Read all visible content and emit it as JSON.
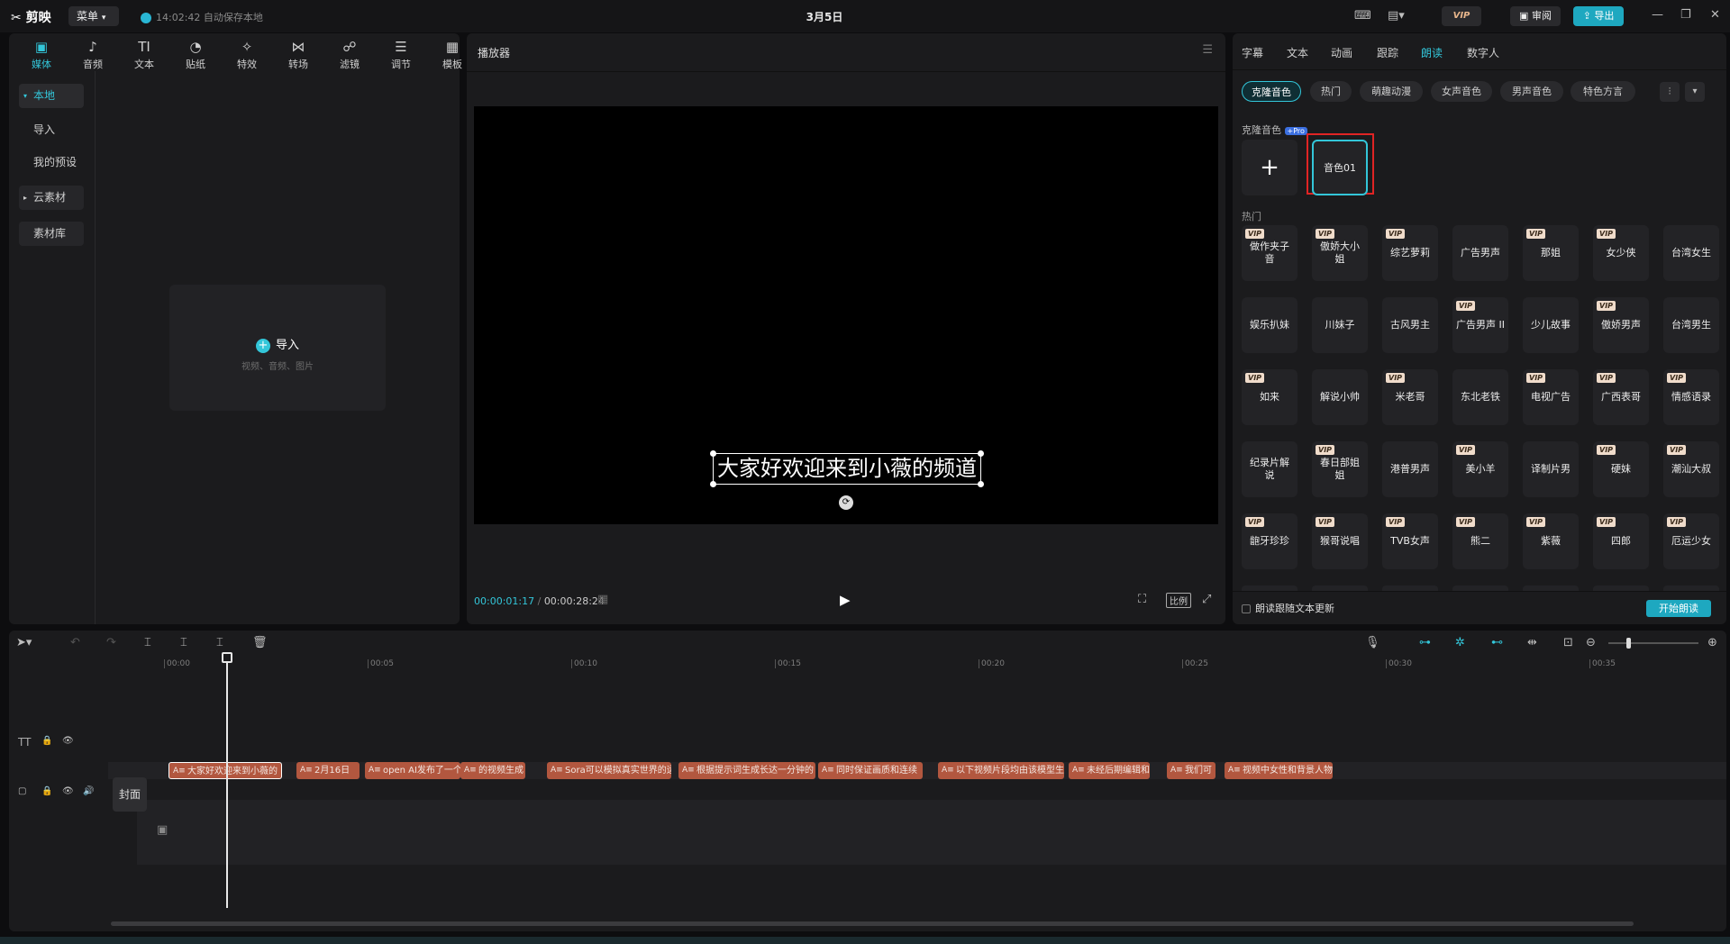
{
  "app": {
    "logo": "剪映",
    "menu": "菜单",
    "autosave": "14:02:42 自动保存本地",
    "title": "3月5日",
    "vip": "VIP",
    "review": "审阅",
    "export": "导出"
  },
  "toolbar": [
    {
      "label": "媒体",
      "icon": "media-icon"
    },
    {
      "label": "音频",
      "icon": "audio-icon"
    },
    {
      "label": "文本",
      "icon": "text-icon"
    },
    {
      "label": "贴纸",
      "icon": "sticker-icon"
    },
    {
      "label": "特效",
      "icon": "effects-icon"
    },
    {
      "label": "转场",
      "icon": "transition-icon"
    },
    {
      "label": "滤镜",
      "icon": "filter-icon"
    },
    {
      "label": "调节",
      "icon": "adjust-icon"
    },
    {
      "label": "模板",
      "icon": "template-icon"
    }
  ],
  "sidebar": {
    "local": "本地",
    "import": "导入",
    "presets": "我的预设",
    "cloud": "云素材",
    "library": "素材库"
  },
  "import_box": {
    "label": "导入",
    "hint": "视频、音频、图片"
  },
  "player": {
    "title": "播放器",
    "caption": "大家好欢迎来到小薇的频道",
    "current_time": "00:00:01:17",
    "total_time": "00:00:28:24",
    "ratio": "比例"
  },
  "right_tabs": [
    "字幕",
    "文本",
    "动画",
    "跟踪",
    "朗读",
    "数字人"
  ],
  "right_active_tab": "朗读",
  "voice_filters": [
    "克隆音色",
    "热门",
    "萌趣动漫",
    "女声音色",
    "男声音色",
    "特色方言"
  ],
  "clone_section": {
    "title": "克隆音色",
    "badge": "+Pro",
    "add": "+",
    "voice": "音色01"
  },
  "hot_section": {
    "title": "热门"
  },
  "voices": [
    {
      "name": "做作夹子音",
      "vip": true
    },
    {
      "name": "傲娇大小姐",
      "vip": true
    },
    {
      "name": "综艺萝莉",
      "vip": true
    },
    {
      "name": "广告男声",
      "vip": false
    },
    {
      "name": "那姐",
      "vip": true
    },
    {
      "name": "女少侠",
      "vip": true
    },
    {
      "name": "台湾女生",
      "vip": false
    },
    {
      "name": "娱乐扒妹",
      "vip": false
    },
    {
      "name": "川妹子",
      "vip": false
    },
    {
      "name": "古风男主",
      "vip": false
    },
    {
      "name": "广告男声 II",
      "vip": true
    },
    {
      "name": "少儿故事",
      "vip": false
    },
    {
      "name": "傲娇男声",
      "vip": true
    },
    {
      "name": "台湾男生",
      "vip": false
    },
    {
      "name": "如来",
      "vip": true
    },
    {
      "name": "解说小帅",
      "vip": false
    },
    {
      "name": "米老哥",
      "vip": true
    },
    {
      "name": "东北老铁",
      "vip": false
    },
    {
      "name": "电视广告",
      "vip": true
    },
    {
      "name": "广西表哥",
      "vip": true
    },
    {
      "name": "情感语录",
      "vip": true
    },
    {
      "name": "纪录片解说",
      "vip": false
    },
    {
      "name": "春日部姐姐",
      "vip": true
    },
    {
      "name": "港普男声",
      "vip": false
    },
    {
      "name": "美小羊",
      "vip": true
    },
    {
      "name": "译制片男",
      "vip": false
    },
    {
      "name": "硬妹",
      "vip": true
    },
    {
      "name": "潮汕大叔",
      "vip": true
    },
    {
      "name": "龅牙珍珍",
      "vip": true
    },
    {
      "name": "猴哥说唱",
      "vip": true
    },
    {
      "name": "TVB女声",
      "vip": true
    },
    {
      "name": "熊二",
      "vip": true
    },
    {
      "name": "紫薇",
      "vip": true
    },
    {
      "name": "四郎",
      "vip": true
    },
    {
      "name": "厄运少女",
      "vip": true
    }
  ],
  "read_footer": {
    "checkbox": "朗读跟随文本更新",
    "start": "开始朗读"
  },
  "timeline": {
    "ticks": [
      "00:00",
      "00:05",
      "00:10",
      "00:15",
      "00:20",
      "00:25",
      "00:30",
      "00:35"
    ],
    "cover": "封面",
    "segments": [
      "大家好欢迎来到小薇的",
      "2月16日",
      "open AI发布了一个",
      "的视频生成",
      "Sora可以模拟真实世界的运",
      "根据提示词生成长达一分钟的",
      "同时保证画质和连续",
      "以下视频片段均由该模型生",
      "未经后期编辑和",
      "我们可",
      "视频中女性和背景人物"
    ]
  },
  "colors": {
    "accent": "#33c6d9",
    "subtitle_clip": "#b2573f",
    "highlight_box": "#e02424"
  }
}
